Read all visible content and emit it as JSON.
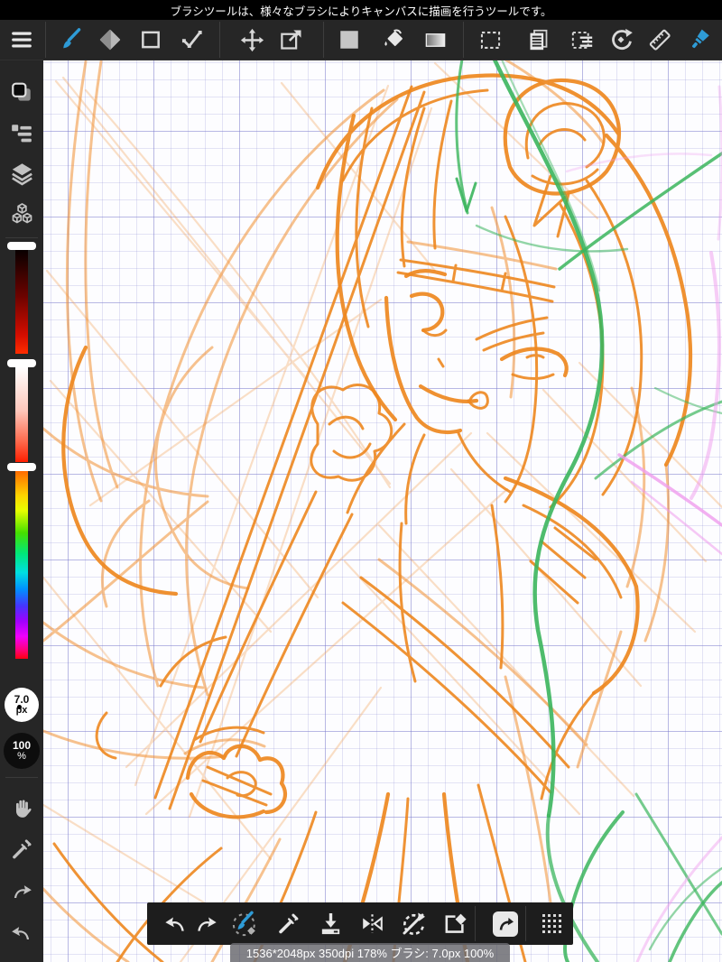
{
  "top_message": {
    "text": "ブラシツールは、様々なブラシによりキャンバスに描画を行うツールです。"
  },
  "top_toolbar": {
    "items": [
      {
        "name": "menu",
        "icon": "hamburger-icon"
      },
      {
        "name": "brush-tool",
        "icon": "brush-icon",
        "active": true
      },
      {
        "name": "eraser-tool",
        "icon": "eraser-icon"
      },
      {
        "name": "shape-tool",
        "icon": "rectangle-icon"
      },
      {
        "name": "polyline-tool",
        "icon": "polyline-icon"
      },
      {
        "name": "move-tool",
        "icon": "move-icon"
      },
      {
        "name": "transform-tool",
        "icon": "transform-icon"
      },
      {
        "name": "color-square",
        "icon": "filled-square-icon"
      },
      {
        "name": "fill-bucket-tool",
        "icon": "bucket-icon"
      },
      {
        "name": "gradient-tool",
        "icon": "gradient-icon"
      },
      {
        "name": "select-tool",
        "icon": "dashed-rect-icon"
      },
      {
        "name": "pages-panel",
        "icon": "document-icon"
      },
      {
        "name": "select-options",
        "icon": "dashed-list-icon"
      },
      {
        "name": "rotate-view",
        "icon": "rotate-icon"
      },
      {
        "name": "ruler-tool",
        "icon": "ruler-icon"
      },
      {
        "name": "brush-picker",
        "icon": "wide-brush-icon"
      }
    ]
  },
  "sidebar": {
    "buttons_top": [
      {
        "name": "color-panel",
        "icon": "color-swatch-icon"
      },
      {
        "name": "brush-list-panel",
        "icon": "panel-list-icon"
      },
      {
        "name": "layers-panel",
        "icon": "layers-icon"
      },
      {
        "name": "materials-panel",
        "icon": "cubes-icon"
      }
    ],
    "sliders": [
      {
        "name": "value-slider"
      },
      {
        "name": "saturation-slider"
      },
      {
        "name": "hue-slider"
      }
    ],
    "brush_size": {
      "value": "7.0",
      "unit": "px"
    },
    "opacity": {
      "value": "100",
      "unit": "%"
    },
    "buttons_bottom": [
      {
        "name": "hand-tool",
        "icon": "hand-icon"
      },
      {
        "name": "eyedropper-tool",
        "icon": "eyedropper-icon"
      },
      {
        "name": "redo",
        "icon": "redo-icon"
      },
      {
        "name": "undo",
        "icon": "undo-icon"
      }
    ]
  },
  "bottom_toolbar": {
    "items": [
      {
        "name": "undo",
        "icon": "undo-icon"
      },
      {
        "name": "redo",
        "icon": "redo-icon"
      },
      {
        "name": "brush-eraser-toggle",
        "icon": "brush-toggle-icon",
        "active": true
      },
      {
        "name": "eyedropper",
        "icon": "eyedropper-icon"
      },
      {
        "name": "save",
        "icon": "save-icon"
      },
      {
        "name": "flip-horizontal",
        "icon": "flip-horizontal-icon"
      },
      {
        "name": "reset-rotation",
        "icon": "no-rotate-icon"
      },
      {
        "name": "clear-layer",
        "icon": "clear-icon"
      },
      {
        "name": "materials",
        "icon": "material-button-icon"
      },
      {
        "name": "grid-menu",
        "icon": "grid-dots-icon"
      }
    ]
  },
  "status_bar": {
    "text": "1536*2048px 350dpi 178% ブラシ: 7.0px 100%"
  },
  "colors": {
    "accent_blue": "#2e9bd6",
    "sketch_orange": "#ee8820",
    "sketch_green": "#3bb55d",
    "sketch_pink": "#ef9ced",
    "grid_minor": "#e4e4f5",
    "grid_major": "#c9c9e9",
    "message_bg": "#000000",
    "toolbar_bg": "#262626",
    "bottom_bar_bg": "#1d1d1d"
  }
}
